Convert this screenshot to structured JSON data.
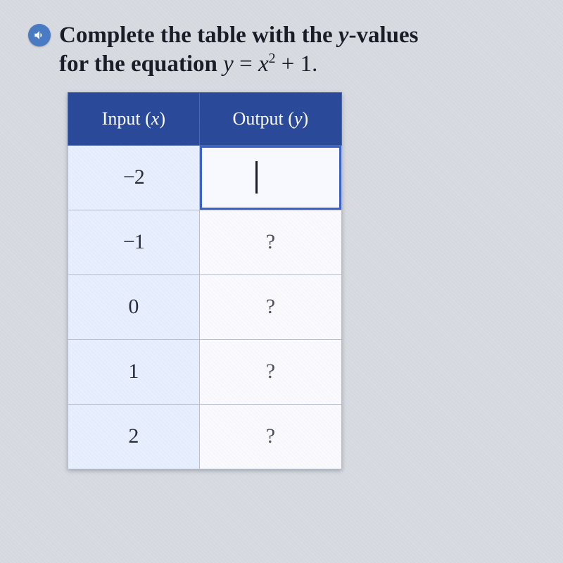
{
  "prompt": {
    "line1_a": "Complete the table with the ",
    "line1_var": "y",
    "line1_b": "-values",
    "line2_a": "for the equation ",
    "eq_lhs": "y",
    "eq_eq": " = ",
    "eq_rhs_var": "x",
    "eq_rhs_sup": "2",
    "eq_plus": " + 1."
  },
  "table": {
    "header_input_a": "Input (",
    "header_input_var": "x",
    "header_input_b": ")",
    "header_output_a": "Output (",
    "header_output_var": "y",
    "header_output_b": ")",
    "rows": [
      {
        "input": "−2",
        "output": ""
      },
      {
        "input": "−1",
        "output": "?"
      },
      {
        "input": "0",
        "output": "?"
      },
      {
        "input": "1",
        "output": "?"
      },
      {
        "input": "2",
        "output": "?"
      }
    ]
  },
  "chart_data": {
    "type": "table",
    "title": "Complete the table with the y-values for the equation y = x^2 + 1.",
    "columns": [
      "Input (x)",
      "Output (y)"
    ],
    "rows": [
      [
        -2,
        null
      ],
      [
        -1,
        "?"
      ],
      [
        0,
        "?"
      ],
      [
        1,
        "?"
      ],
      [
        2,
        "?"
      ]
    ],
    "equation": "y = x^2 + 1"
  }
}
